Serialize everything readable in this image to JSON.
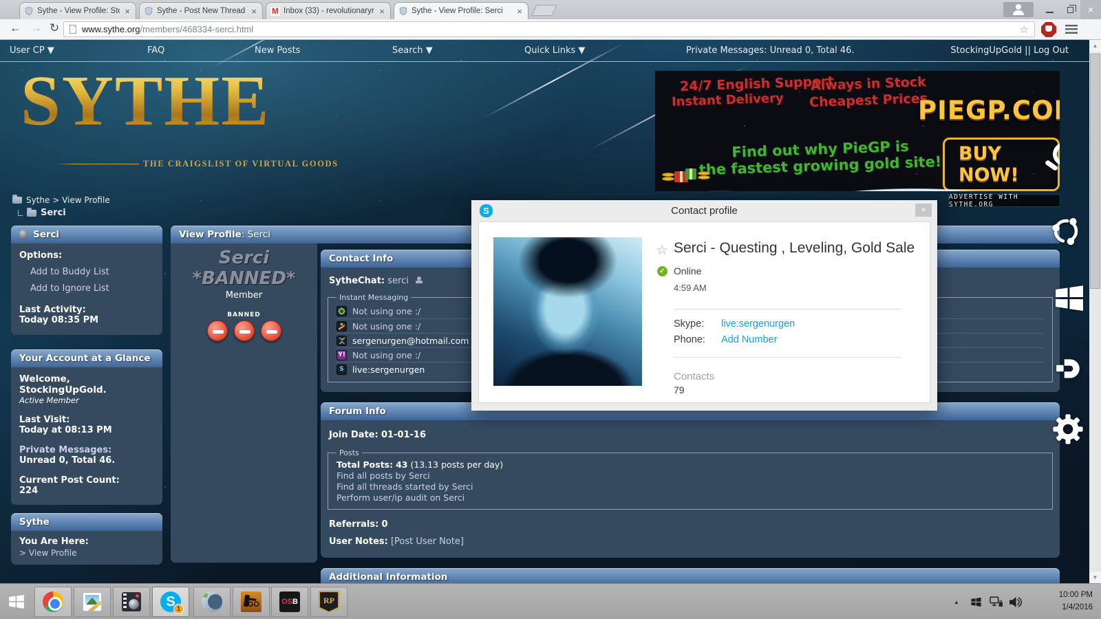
{
  "glyphs": {
    "close": "×",
    "back": "←",
    "forward": "→",
    "reload": "↻",
    "star_outline": "☆",
    "check": "✓",
    "scroll_up": "▲",
    "scroll_down": "▼",
    "tray_up": "▲",
    "gmail_m": "M",
    "yahoo": "Y!",
    "skype_s": "S"
  },
  "browser": {
    "tabs": [
      {
        "title": "Sythe - View Profile: Stock"
      },
      {
        "title": "Sythe - Post New Thread"
      },
      {
        "title": "Inbox (33) - revolutionaryr"
      },
      {
        "title": "Sythe - View Profile: Serci"
      }
    ],
    "url_host": "www.sythe.org",
    "url_path": "/members/468334-serci.html"
  },
  "navbar": {
    "user_cp": "User CP ▼",
    "faq": "FAQ",
    "new_posts": "New Posts",
    "search": "Search ▼",
    "quick_links": "Quick Links ▼",
    "private_messages": "Private Messages: Unread 0, Total 46.",
    "account": "StockingUpGold || Log Out"
  },
  "header": {
    "logo": "SYTHE",
    "tagline": "THE CRAIGSLIST OF VIRTUAL GOODS",
    "ad": {
      "support": "24/7 English Support",
      "delivery": "Instant Delivery",
      "stock": "Always in Stock",
      "prices": "Cheapest Prices",
      "brand": "PIEGP.COM",
      "pitch1": "Find out why PieGP is",
      "pitch2": "the fastest growing gold site!",
      "buy": "BUY NOW!"
    },
    "advertise": "ADVERTISE WITH SYTHE.ORG"
  },
  "breadcrumb": {
    "path": "Sythe > View Profile",
    "current": "Serci"
  },
  "sidebar": {
    "profile": {
      "title": "Serci",
      "options": "Options:",
      "buddy": "Add to Buddy List",
      "ignore": "Add to Ignore List",
      "activity_label": "Last Activity:",
      "activity_value": "Today 08:35 PM"
    },
    "account": {
      "title": "Your Account at a Glance",
      "welcome": "Welcome, StockingUpGold.",
      "rank": "Active Member",
      "visit_label": "Last Visit:",
      "visit_value": "Today at 08:13 PM",
      "pm_label": "Private Messages:",
      "pm_value": "Unread 0, Total 46.",
      "count_label": "Current Post Count:",
      "count_value": "224"
    },
    "sythe": {
      "title": "Sythe",
      "here_label": "You Are Here:",
      "here_value": "> View Profile"
    }
  },
  "main": {
    "title_bold": "View Profile",
    "title_rest": ": Serci",
    "profile": {
      "name": "Serci *BANNED*",
      "rank": "Member",
      "banned": "BANNED"
    },
    "contact": {
      "title": "Contact Info",
      "sythechat_label": "SytheChat:",
      "sythechat_value": "serci",
      "im_legend": "Instant Messaging",
      "im_rows": [
        {
          "icon": "icq-icon",
          "text": "Not using one :/"
        },
        {
          "icon": "aim-icon",
          "text": "Not using one :/"
        },
        {
          "icon": "msn-icon",
          "text": "sergenurgen@hotmail.com"
        },
        {
          "icon": "yahoo-icon",
          "text": "Not using one :/"
        },
        {
          "icon": "skype-icon",
          "text": "live:sergenurgen"
        }
      ]
    },
    "forum": {
      "title": "Forum Info",
      "join_label": "Join Date:",
      "join_value": "01-01-16",
      "posts_legend": "Posts",
      "total_label": "Total Posts:",
      "total_value": "43",
      "total_rest": " (13.13 posts per day)",
      "link1": "Find all posts by Serci",
      "link2": "Find all threads started by Serci",
      "link3": "Perform user/ip audit on Serci",
      "referrals_label": "Referrals:",
      "referrals_value": "0",
      "notes_label": "User Notes:",
      "notes_link": "[Post User Note]"
    },
    "additional_title": "Additional Information"
  },
  "skype": {
    "title": "Contact profile",
    "name": "Serci - Questing , Leveling, Gold Sale",
    "status": "Online",
    "time": "4:59 AM",
    "skype_label": "Skype:",
    "skype_value": "live:sergenurgen",
    "phone_label": "Phone:",
    "phone_link": "Add Number",
    "contacts_label": "Contacts",
    "contacts_value": "79"
  },
  "taskbar": {
    "skype_badge": "1",
    "csgo_label": "GO",
    "osb_red": "OS",
    "osb_white": "B",
    "rp_label": "RP",
    "time": "10:00 PM",
    "date": "1/4/2016"
  },
  "colors": {
    "skype_blue": "#00aff0",
    "banned_red": "#d93a27",
    "gold": "#ffc43d",
    "link_lavender": "#cdd0ea",
    "ad_red": "#c92f2f",
    "ad_green": "#44b234",
    "panel_blue": "#5d84b2",
    "panel_body": "#35495f"
  }
}
